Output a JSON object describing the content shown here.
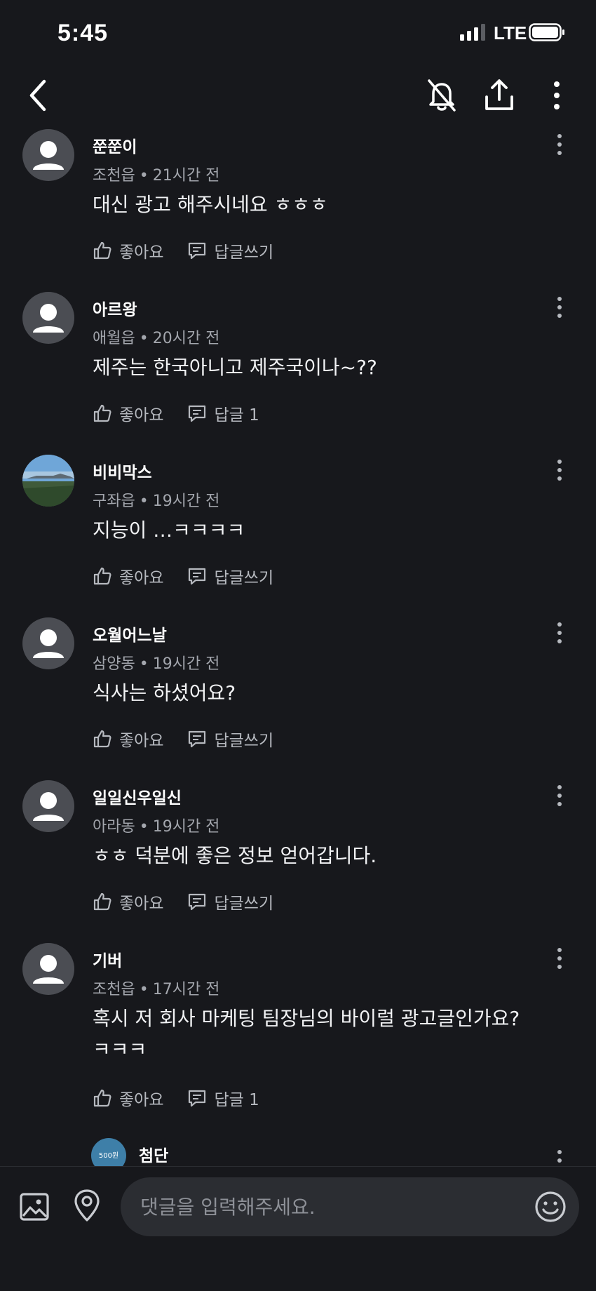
{
  "status_bar": {
    "time": "5:45",
    "network": "LTE"
  },
  "comments": [
    {
      "username": "쭌쭌이",
      "location": "조천읍",
      "time": "21시간 전",
      "text": "대신 광고 해주시네요 ㅎㅎㅎ",
      "like_label": "좋아요",
      "reply_label": "답글쓰기",
      "avatar": "default"
    },
    {
      "username": "아르왕",
      "location": "애월읍",
      "time": "20시간 전",
      "text": "제주는 한국아니고 제주국이나~??",
      "like_label": "좋아요",
      "reply_label": "답글 1",
      "avatar": "default"
    },
    {
      "username": "비비막스",
      "location": "구좌읍",
      "time": "19시간 전",
      "text": "지능이 …ㅋㅋㅋㅋ",
      "like_label": "좋아요",
      "reply_label": "답글쓰기",
      "avatar": "photo"
    },
    {
      "username": "오월어느날",
      "location": "삼양동",
      "time": "19시간 전",
      "text": "식사는 하셨어요?",
      "like_label": "좋아요",
      "reply_label": "답글쓰기",
      "avatar": "default"
    },
    {
      "username": "일일신우일신",
      "location": "아라동",
      "time": "19시간 전",
      "text": "ㅎㅎ 덕분에 좋은 정보 얻어갑니다.",
      "like_label": "좋아요",
      "reply_label": "답글쓰기",
      "avatar": "default"
    },
    {
      "username": "기버",
      "location": "조천읍",
      "time": "17시간 전",
      "text": "혹시 저 회사 마케팅 팀장님의 바이럴 광고글인가요?",
      "text_line2": "ㅋㅋㅋ",
      "like_label": "좋아요",
      "reply_label": "답글 1",
      "avatar": "default"
    }
  ],
  "reply": {
    "username": "첨단",
    "badge": "500원"
  },
  "input": {
    "placeholder": "댓글을 입력해주세요."
  },
  "colors": {
    "background": "#17181c",
    "input_bg": "#2b2d32",
    "meta": "#a3a6ad"
  }
}
